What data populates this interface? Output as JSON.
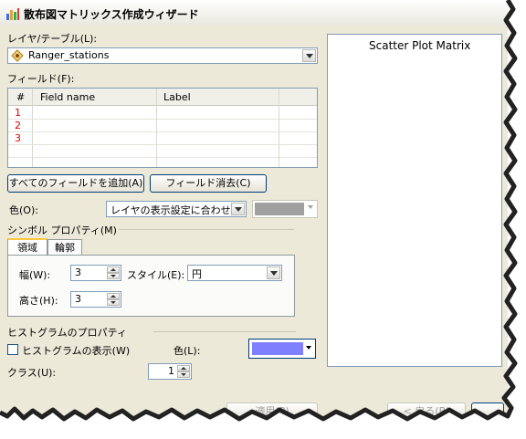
{
  "window": {
    "title": "散布図マトリックス作成ウィザード",
    "icon": "chart-icon"
  },
  "layer": {
    "label": "レイヤ/テーブル(L):",
    "value": "Ranger_stations",
    "icon": "point-layer-icon"
  },
  "fields": {
    "label": "フィールド(F):",
    "columns": [
      "#",
      "Field name",
      "Label"
    ],
    "rows": [
      "1",
      "2",
      "3"
    ],
    "add_all_button": "すべてのフィールドを追加(A)",
    "clear_button": "フィールド消去(C)"
  },
  "color": {
    "label": "色(O):",
    "value": "レイヤの表示設定に合わせる",
    "swatch": "#a0a0a0"
  },
  "symbol": {
    "group_label": "シンボル プロパティ(M)",
    "tabs": [
      "領域",
      "輪郭"
    ],
    "width_label": "幅(W):",
    "width_value": "3",
    "height_label": "高さ(H):",
    "height_value": "3",
    "style_label": "スタイル(E):",
    "style_value": "円"
  },
  "histogram": {
    "group_label": "ヒストグラムのプロパティ",
    "show_label": "ヒストグラムの表示(W)",
    "color_label": "色(L):",
    "color_swatch": "#8080ff",
    "class_label": "クラス(U):",
    "class_value": "1"
  },
  "preview": {
    "title": "Scatter Plot Matrix"
  },
  "footer": {
    "apply_label": "適用(P)",
    "back_label": "< 戻る(B)"
  }
}
